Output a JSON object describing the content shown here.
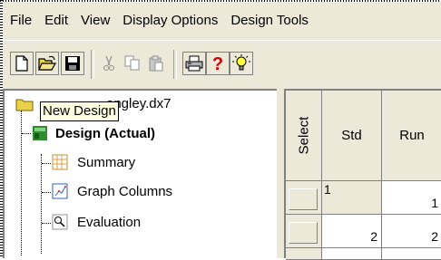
{
  "menubar": {
    "items": [
      "File",
      "Edit",
      "View",
      "Display Options",
      "Design Tools"
    ]
  },
  "toolbar": {
    "buttons": [
      "new-icon",
      "open-icon",
      "save-icon",
      "cut-icon",
      "copy-icon",
      "paste-icon",
      "print-icon",
      "help-icon",
      "tip-icon"
    ]
  },
  "tree": {
    "root_label": "ongley.dx7",
    "tooltip": "New Design",
    "items": {
      "design": "Design (Actual)",
      "summary": "Summary",
      "graph_columns": "Graph Columns",
      "evaluation": "Evaluation"
    }
  },
  "grid": {
    "headers": {
      "select": "Select",
      "std": "Std",
      "run": "Run"
    },
    "rows": [
      {
        "std": "1",
        "run": "1"
      },
      {
        "std": "2",
        "run": "2"
      }
    ]
  },
  "colors": {
    "chrome": "#ece9d8",
    "tooltip": "#ffffe1",
    "folder": "#e8d24a"
  }
}
